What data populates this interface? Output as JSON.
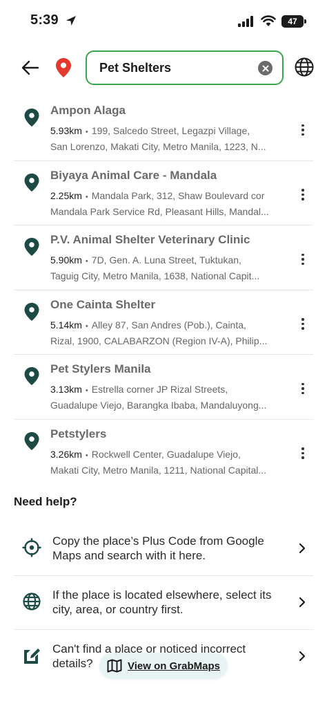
{
  "status_bar": {
    "time": "5:39",
    "battery": "47"
  },
  "search": {
    "value": "Pet Shelters",
    "placeholder": ""
  },
  "results": [
    {
      "name": "Ampon Alaga",
      "distance": "5.93km",
      "address_line1": "199, Salcedo Street, Legazpi Village,",
      "address_line2": "San Lorenzo, Makati City, Metro Manila, 1223, N..."
    },
    {
      "name": "Biyaya Animal Care - Mandala",
      "distance": "2.25km",
      "address_line1": "Mandala Park, 312, Shaw Boulevard cor",
      "address_line2": "Mandala Park Service Rd, Pleasant Hills, Mandal..."
    },
    {
      "name": "P.V. Animal Shelter Veterinary Clinic",
      "distance": "5.90km",
      "address_line1": "7D, Gen. A. Luna Street, Tuktukan,",
      "address_line2": "Taguig City, Metro Manila, 1638, National Capit..."
    },
    {
      "name": "One Cainta Shelter",
      "distance": "5.14km",
      "address_line1": "Alley 87, San Andres (Pob.), Cainta,",
      "address_line2": "Rizal, 1900, CALABARZON (Region IV-A), Philip..."
    },
    {
      "name": "Pet Stylers Manila",
      "distance": "3.13km",
      "address_line1": "Estrella corner JP Rizal Streets,",
      "address_line2": "Guadalupe Viejo, Barangka Ibaba, Mandaluyong..."
    },
    {
      "name": "Petstylers",
      "distance": "3.26km",
      "address_line1": "Rockwell Center, Guadalupe Viejo,",
      "address_line2": "Makati City, Metro Manila, 1211, National Capital..."
    }
  ],
  "separator": "•",
  "help": {
    "title": "Need help?",
    "items": [
      {
        "text": "Copy the place’s Plus Code from Google Maps and search with it here.",
        "icon": "crosshair-icon"
      },
      {
        "text": "If the place is located elsewhere, select its city, area, or country first.",
        "icon": "globe-icon"
      },
      {
        "text": "Can't find a place or noticed incorrect details?",
        "icon": "edit-note-icon"
      }
    ]
  },
  "map_button": {
    "label": "View on GrabMaps"
  },
  "colors": {
    "pin_dark": "#1e4a46",
    "pin_red": "#e4392c",
    "search_border": "#3aa44a",
    "map_button_bg": "#e6f3f2"
  }
}
